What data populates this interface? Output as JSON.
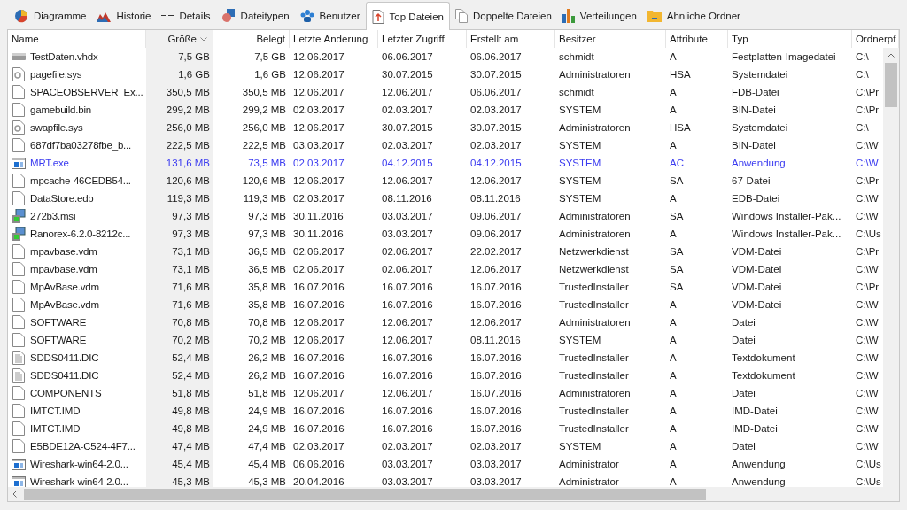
{
  "tabs": [
    {
      "label": "Diagramme",
      "selected": false
    },
    {
      "label": "Historie",
      "selected": false
    },
    {
      "label": "Details",
      "selected": false
    },
    {
      "label": "Dateitypen",
      "selected": false
    },
    {
      "label": "Benutzer",
      "selected": false
    },
    {
      "label": "Top Dateien",
      "selected": true
    },
    {
      "label": "Doppelte Dateien",
      "selected": false
    },
    {
      "label": "Verteilungen",
      "selected": false
    },
    {
      "label": "Ähnliche Ordner",
      "selected": false
    }
  ],
  "table": {
    "columns": [
      {
        "label": "Name",
        "sorted": false
      },
      {
        "label": "Größe",
        "sorted": true
      },
      {
        "label": "Belegt",
        "sorted": false
      },
      {
        "label": "Letzte Änderung",
        "sorted": false
      },
      {
        "label": "Letzter Zugriff",
        "sorted": false
      },
      {
        "label": "Erstellt am",
        "sorted": false
      },
      {
        "label": "Besitzer",
        "sorted": false
      },
      {
        "label": "Attribute",
        "sorted": false
      },
      {
        "label": "Typ",
        "sorted": false
      },
      {
        "label": "Ordnerpf",
        "sorted": false
      }
    ],
    "rows": [
      {
        "kind": "drive",
        "compressed": false,
        "cells": [
          "TestDaten.vhdx",
          "7,5 GB",
          "7,5 GB",
          "12.06.2017",
          "06.06.2017",
          "06.06.2017",
          "schmidt",
          "A",
          "Festplatten-Imagedatei",
          "C:\\"
        ]
      },
      {
        "kind": "system",
        "compressed": false,
        "cells": [
          "pagefile.sys",
          "1,6 GB",
          "1,6 GB",
          "12.06.2017",
          "30.07.2015",
          "30.07.2015",
          "Administratoren",
          "HSA",
          "Systemdatei",
          "C:\\"
        ]
      },
      {
        "kind": "file",
        "compressed": false,
        "cells": [
          "SPACEOBSERVER_Ex...",
          "350,5 MB",
          "350,5 MB",
          "12.06.2017",
          "12.06.2017",
          "06.06.2017",
          "schmidt",
          "A",
          "FDB-Datei",
          "C:\\Pr"
        ]
      },
      {
        "kind": "file",
        "compressed": false,
        "cells": [
          "gamebuild.bin",
          "299,2 MB",
          "299,2 MB",
          "02.03.2017",
          "02.03.2017",
          "02.03.2017",
          "SYSTEM",
          "A",
          "BIN-Datei",
          "C:\\Pr"
        ]
      },
      {
        "kind": "system",
        "compressed": false,
        "cells": [
          "swapfile.sys",
          "256,0 MB",
          "256,0 MB",
          "12.06.2017",
          "30.07.2015",
          "30.07.2015",
          "Administratoren",
          "HSA",
          "Systemdatei",
          "C:\\"
        ]
      },
      {
        "kind": "file",
        "compressed": false,
        "cells": [
          "687df7ba03278fbe_b...",
          "222,5 MB",
          "222,5 MB",
          "03.03.2017",
          "02.03.2017",
          "02.03.2017",
          "SYSTEM",
          "A",
          "BIN-Datei",
          "C:\\W"
        ]
      },
      {
        "kind": "app",
        "compressed": true,
        "cells": [
          "MRT.exe",
          "131,6 MB",
          "73,5 MB",
          "02.03.2017",
          "04.12.2015",
          "04.12.2015",
          "SYSTEM",
          "AC",
          "Anwendung",
          "C:\\W"
        ]
      },
      {
        "kind": "file",
        "compressed": false,
        "cells": [
          "mpcache-46CEDB54...",
          "120,6 MB",
          "120,6 MB",
          "12.06.2017",
          "12.06.2017",
          "12.06.2017",
          "SYSTEM",
          "SA",
          "67-Datei",
          "C:\\Pr"
        ]
      },
      {
        "kind": "file",
        "compressed": false,
        "cells": [
          "DataStore.edb",
          "119,3 MB",
          "119,3 MB",
          "02.03.2017",
          "08.11.2016",
          "08.11.2016",
          "SYSTEM",
          "A",
          "EDB-Datei",
          "C:\\W"
        ]
      },
      {
        "kind": "installer",
        "compressed": false,
        "cells": [
          "272b3.msi",
          "97,3 MB",
          "97,3 MB",
          "30.11.2016",
          "03.03.2017",
          "09.06.2017",
          "Administratoren",
          "SA",
          "Windows Installer-Pak...",
          "C:\\W"
        ]
      },
      {
        "kind": "installer",
        "compressed": false,
        "cells": [
          "Ranorex-6.2.0-8212c...",
          "97,3 MB",
          "97,3 MB",
          "30.11.2016",
          "03.03.2017",
          "09.06.2017",
          "Administratoren",
          "A",
          "Windows Installer-Pak...",
          "C:\\Us"
        ]
      },
      {
        "kind": "file",
        "compressed": false,
        "cells": [
          "mpavbase.vdm",
          "73,1 MB",
          "36,5 MB",
          "02.06.2017",
          "02.06.2017",
          "22.02.2017",
          "Netzwerkdienst",
          "SA",
          "VDM-Datei",
          "C:\\Pr"
        ]
      },
      {
        "kind": "file",
        "compressed": false,
        "cells": [
          "mpavbase.vdm",
          "73,1 MB",
          "36,5 MB",
          "02.06.2017",
          "02.06.2017",
          "12.06.2017",
          "Netzwerkdienst",
          "SA",
          "VDM-Datei",
          "C:\\W"
        ]
      },
      {
        "kind": "file",
        "compressed": false,
        "cells": [
          "MpAvBase.vdm",
          "71,6 MB",
          "35,8 MB",
          "16.07.2016",
          "16.07.2016",
          "16.07.2016",
          "TrustedInstaller",
          "SA",
          "VDM-Datei",
          "C:\\Pr"
        ]
      },
      {
        "kind": "file",
        "compressed": false,
        "cells": [
          "MpAvBase.vdm",
          "71,6 MB",
          "35,8 MB",
          "16.07.2016",
          "16.07.2016",
          "16.07.2016",
          "TrustedInstaller",
          "A",
          "VDM-Datei",
          "C:\\W"
        ]
      },
      {
        "kind": "file",
        "compressed": false,
        "cells": [
          "SOFTWARE",
          "70,8 MB",
          "70,8 MB",
          "12.06.2017",
          "12.06.2017",
          "12.06.2017",
          "Administratoren",
          "A",
          "Datei",
          "C:\\W"
        ]
      },
      {
        "kind": "file",
        "compressed": false,
        "cells": [
          "SOFTWARE",
          "70,2 MB",
          "70,2 MB",
          "12.06.2017",
          "12.06.2017",
          "08.11.2016",
          "SYSTEM",
          "A",
          "Datei",
          "C:\\W"
        ]
      },
      {
        "kind": "text",
        "compressed": false,
        "cells": [
          "SDDS0411.DIC",
          "52,4 MB",
          "26,2 MB",
          "16.07.2016",
          "16.07.2016",
          "16.07.2016",
          "TrustedInstaller",
          "A",
          "Textdokument",
          "C:\\W"
        ]
      },
      {
        "kind": "text",
        "compressed": false,
        "cells": [
          "SDDS0411.DIC",
          "52,4 MB",
          "26,2 MB",
          "16.07.2016",
          "16.07.2016",
          "16.07.2016",
          "TrustedInstaller",
          "A",
          "Textdokument",
          "C:\\W"
        ]
      },
      {
        "kind": "file",
        "compressed": false,
        "cells": [
          "COMPONENTS",
          "51,8 MB",
          "51,8 MB",
          "12.06.2017",
          "12.06.2017",
          "16.07.2016",
          "Administratoren",
          "A",
          "Datei",
          "C:\\W"
        ]
      },
      {
        "kind": "file",
        "compressed": false,
        "cells": [
          "IMTCT.IMD",
          "49,8 MB",
          "24,9 MB",
          "16.07.2016",
          "16.07.2016",
          "16.07.2016",
          "TrustedInstaller",
          "A",
          "IMD-Datei",
          "C:\\W"
        ]
      },
      {
        "kind": "file",
        "compressed": false,
        "cells": [
          "IMTCT.IMD",
          "49,8 MB",
          "24,9 MB",
          "16.07.2016",
          "16.07.2016",
          "16.07.2016",
          "TrustedInstaller",
          "A",
          "IMD-Datei",
          "C:\\W"
        ]
      },
      {
        "kind": "file",
        "compressed": false,
        "cells": [
          "E5BDE12A-C524-4F7...",
          "47,4 MB",
          "47,4 MB",
          "02.03.2017",
          "02.03.2017",
          "02.03.2017",
          "SYSTEM",
          "A",
          "Datei",
          "C:\\W"
        ]
      },
      {
        "kind": "app",
        "compressed": false,
        "cells": [
          "Wireshark-win64-2.0...",
          "45,4 MB",
          "45,4 MB",
          "06.06.2016",
          "03.03.2017",
          "03.03.2017",
          "Administrator",
          "A",
          "Anwendung",
          "C:\\Us"
        ]
      },
      {
        "kind": "app",
        "compressed": false,
        "cells": [
          "Wireshark-win64-2.0...",
          "45,3 MB",
          "45,3 MB",
          "20.04.2016",
          "03.03.2017",
          "03.03.2017",
          "Administrator",
          "A",
          "Anwendung",
          "C:\\Us"
        ]
      }
    ]
  }
}
